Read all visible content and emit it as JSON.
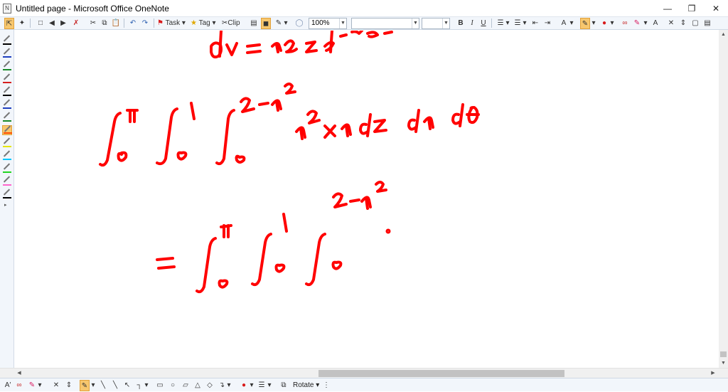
{
  "window": {
    "title": "Untitled page - Microsoft Office OneNote",
    "minimize_icon": "minimize-icon",
    "restore_icon": "restore-icon",
    "close_icon": "close-icon"
  },
  "toolbar": {
    "task_label": "Task",
    "tag_label": "Tag",
    "clip_label": "Clip",
    "zoom_value": "100%",
    "font_value": "",
    "size_value": "",
    "bold": "B",
    "italic": "I",
    "underline": "U",
    "ax_label": "A"
  },
  "drawbar": {
    "rotate_label": "Rotate"
  },
  "colors": {
    "ink": "#ff0000",
    "active_highlight": "#f7c76e",
    "toolbar_bg": "#f2f6fb"
  },
  "pens": [
    {
      "color": "#000000"
    },
    {
      "color": "#1f3fbf"
    },
    {
      "color": "#1a8a2a"
    },
    {
      "color": "#d61f1f"
    },
    {
      "color": "#000000"
    },
    {
      "color": "#1f3fbf"
    },
    {
      "color": "#1a8a2a"
    },
    {
      "color": "#ff4d00",
      "active": true
    },
    {
      "color": "#e6e600"
    },
    {
      "color": "#00c8ff"
    },
    {
      "color": "#22d622"
    },
    {
      "color": "#ff66cc"
    },
    {
      "color": "#000000"
    }
  ]
}
